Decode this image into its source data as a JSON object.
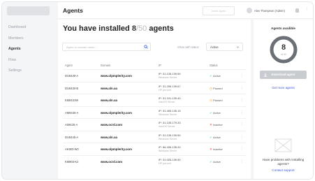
{
  "sidebar": {
    "items": [
      {
        "label": "Dashboard",
        "active": false
      },
      {
        "label": "Members",
        "active": false
      },
      {
        "label": "Agents",
        "active": true
      },
      {
        "label": "Flow",
        "active": false
      },
      {
        "label": "Settings",
        "active": false
      }
    ]
  },
  "header": {
    "title": "Agents",
    "action_label": "Invite agent",
    "user_name": "Alex Thompson (Admin)"
  },
  "main": {
    "heading_prefix": "You have installed",
    "installed": "8",
    "total": "/50",
    "heading_suffix": "agents",
    "search_placeholder": "Agent or domain name ...",
    "filter_label": "Show with status",
    "filter_value": "Active",
    "columns": [
      "Agent",
      "Domain",
      "IP",
      "Status"
    ],
    "rows": [
      {
        "agent": "DU9430-A",
        "domain": "www.olpmplerity.com",
        "ip": "IP: 31.135.139.50",
        "os": "Windows Server",
        "status": "Active",
        "status_kind": "active"
      },
      {
        "agent": "DU9430-B",
        "domain": "www.aln.ua",
        "ip": "IP: 31.295.139.67",
        "os": "HP pro.unit",
        "status": "Paused",
        "status_kind": "paused"
      },
      {
        "agent": "KM9431W",
        "domain": "www.aln.ua",
        "ip": "IP: 31.191.139.40",
        "os": "macOS Server",
        "status": "Paused",
        "status_kind": "paused"
      },
      {
        "agent": "AM9430-A",
        "domain": "www.olpmplerity.com",
        "ip": "IP: 31.405.135.15",
        "os": "Windows Server",
        "status": "Active",
        "status_kind": "active"
      },
      {
        "agent": "A09430-A",
        "domain": "www.ocrd.com",
        "ip": "IP: 31.135.179.33",
        "os": "macOS Server",
        "status": "Inactive",
        "status_kind": "inactive"
      },
      {
        "agent": "DU9445-A",
        "domain": "www.aln.ua",
        "ip": "IP: 31.135.139.50",
        "os": "Windows Server",
        "status": "Active",
        "status_kind": "active"
      },
      {
        "agent": "AK903-W2",
        "domain": "www.olpmplerity.com",
        "ip": "IP: 56.435.135.20",
        "os": "Windows Server",
        "status": "Inactive",
        "status_kind": "inactive"
      },
      {
        "agent": "KM903-K2",
        "domain": "www.ocrd.com",
        "ip": "IP: 31.025.139.50",
        "os": "HP pro.unit",
        "status": "Active",
        "status_kind": "active"
      }
    ]
  },
  "panel": {
    "title": "Agents availible",
    "available": "8",
    "of_total": "of 50",
    "available_fraction": 0.16,
    "download_label": "Download agent",
    "more_label": "Get more agents",
    "help_text": "Have problems with installing agents?",
    "support_label": "Contact support"
  },
  "colors": {
    "active": "#2fb36b",
    "paused": "#f0a030",
    "inactive": "#e0484a",
    "link": "#3b5bdb",
    "ring": "#6b6f76"
  }
}
